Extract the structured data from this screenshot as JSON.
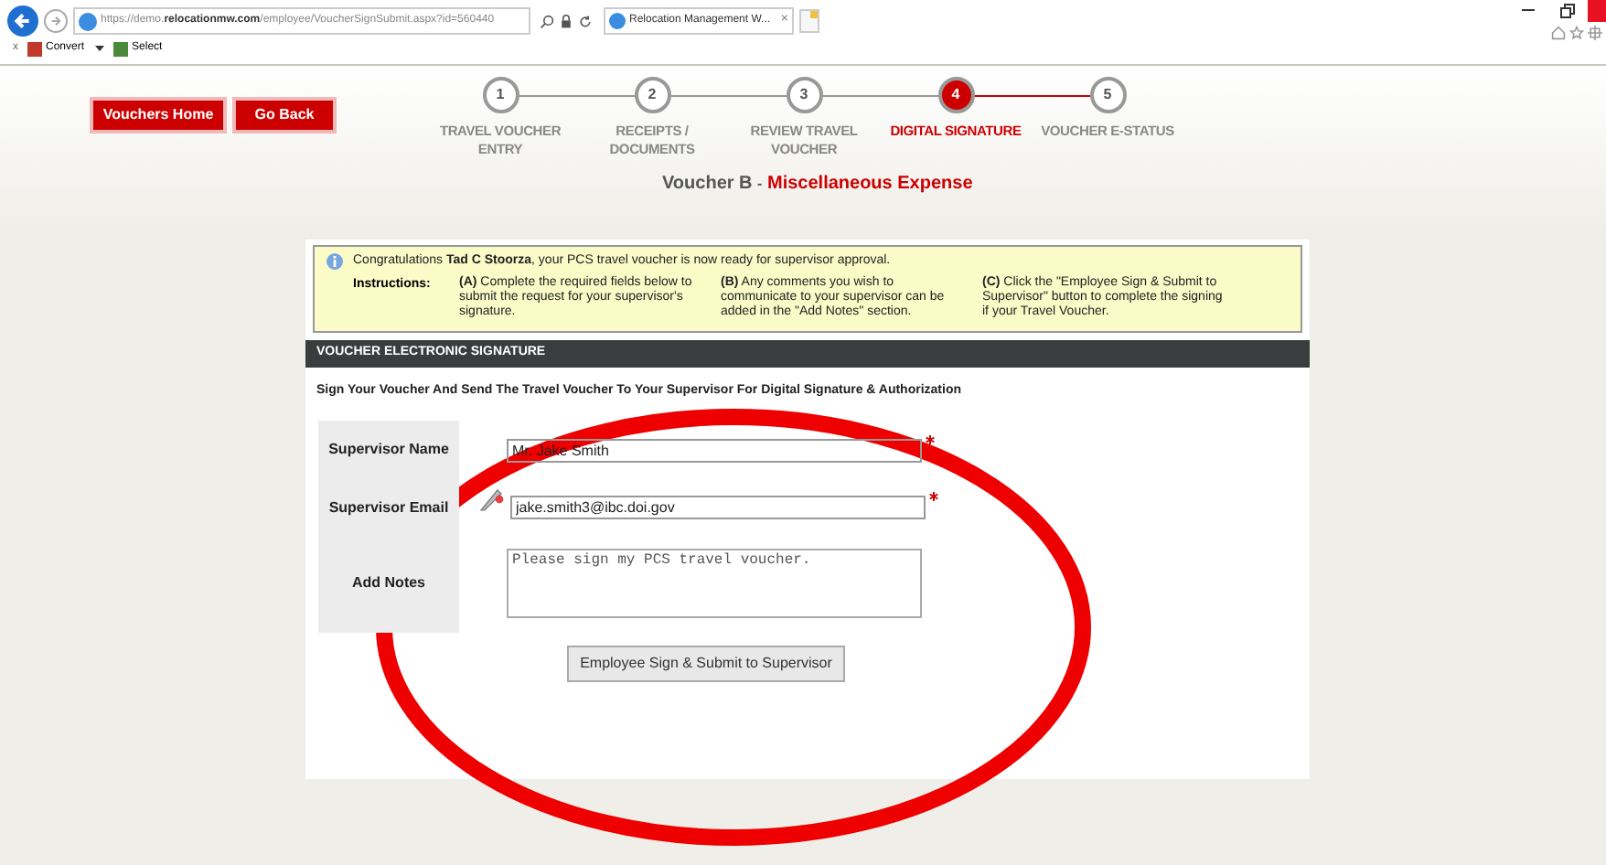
{
  "browser": {
    "url_prefix": "https://demo.",
    "url_domain": "relocationmw.com",
    "url_path": "/employee/VoucherSignSubmit.aspx?id=560440",
    "tab_title": "Relocation Management W...",
    "tab_close": "×",
    "toolbar_close": "x",
    "toolbar_items": [
      {
        "label": "Convert",
        "has_dropdown": true
      },
      {
        "label": "Select",
        "has_dropdown": false
      }
    ]
  },
  "nav_buttons": [
    "Vouchers Home",
    "Go Back"
  ],
  "steps": [
    {
      "number": "1",
      "label": "TRAVEL VOUCHER ENTRY",
      "selected": false
    },
    {
      "number": "2",
      "label": "RECEIPTS / DOCUMENTS",
      "selected": false
    },
    {
      "number": "3",
      "label": "REVIEW TRAVEL VOUCHER",
      "selected": false
    },
    {
      "number": "4",
      "label": "DIGITAL SIGNATURE",
      "selected": true
    },
    {
      "number": "5",
      "label": "VOUCHER E-STATUS",
      "selected": false
    }
  ],
  "heading": {
    "prefix": "Voucher B",
    "separator": "-",
    "title": "Miscellaneous Expense"
  },
  "notice": {
    "message": "Congratulations **Tad C Stoorza**, your PCS travel voucher is now ready for supervisor approval.",
    "instructions_label": "Instructions:",
    "instructions": [
      "**(A)** Complete the required fields below to submit the request for your supervisor's signature.",
      "**(B)** Any comments you wish to communicate to your supervisor can be added in the \"Add Notes\" section.",
      "**(C)** Click the \"Employee Sign & Submit to Supervisor\" button to complete the signing if your Travel Voucher."
    ]
  },
  "section": {
    "title": "VOUCHER ELECTRONIC SIGNATURE",
    "subtitle": "Sign Your Voucher And Send The Travel Voucher To Your Supervisor For Digital Signature & Authorization"
  },
  "form": {
    "fields": [
      {
        "label": "Supervisor Name",
        "value": "Mr. Jake Smith",
        "required": true,
        "kind": "input"
      },
      {
        "label": "Supervisor Email",
        "value": "jake.smith3@ibc.doi.gov",
        "required": true,
        "kind": "input"
      },
      {
        "label": "Add Notes",
        "value": "Please sign my PCS travel voucher.",
        "required": false,
        "kind": "textarea"
      }
    ],
    "submit": "Employee Sign & Submit to Supervisor"
  }
}
